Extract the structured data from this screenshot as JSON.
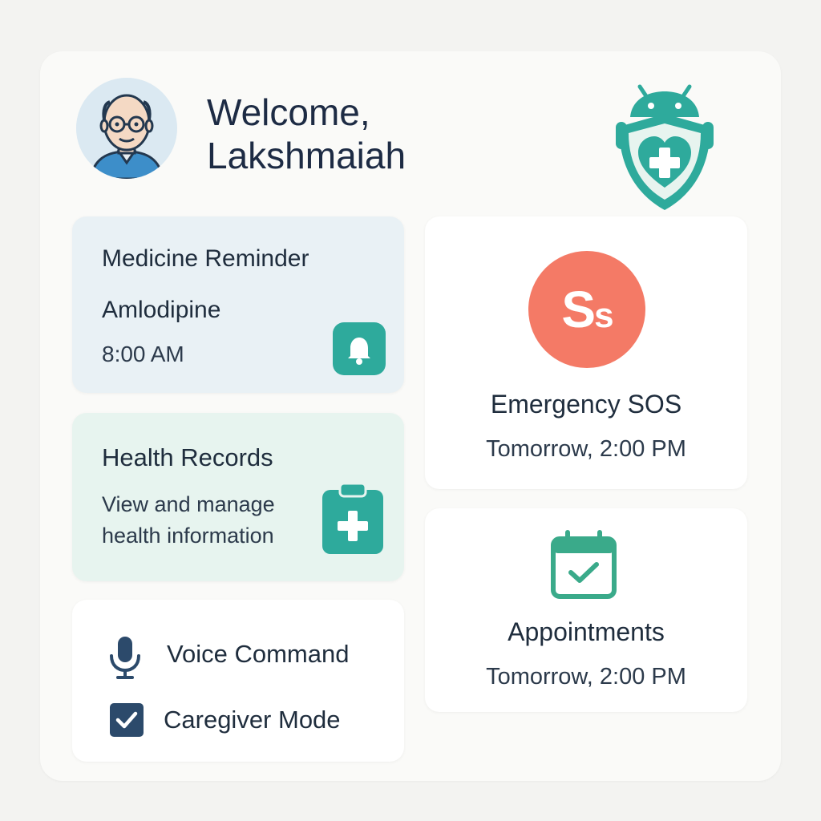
{
  "header": {
    "welcome_line1": "Welcome,",
    "welcome_line2": "Lakshmaiah"
  },
  "medicine_reminder": {
    "title": "Medicine Reminder",
    "medicine": "Amlodipine",
    "time": "8:00 AM",
    "icon": "bell-icon"
  },
  "health_records": {
    "title": "Health Records",
    "desc_line1": "View and manage",
    "desc_line2": "health information",
    "icon": "clipboard-medical-icon"
  },
  "emergency_sos": {
    "badge_big": "S",
    "badge_small": "s",
    "title": "Emergency SOS",
    "subtitle": "Tomorrow, 2:00 PM"
  },
  "appointments": {
    "title": "Appointments",
    "subtitle": "Tomorrow, 2:00 PM",
    "icon": "calendar-check-icon"
  },
  "options": {
    "voice_command": "Voice Command",
    "caregiver_mode": "Caregiver Mode",
    "caregiver_mode_checked": true
  },
  "colors": {
    "teal": "#2eaa9c",
    "coral": "#f47a66",
    "navy": "#2c4a6b",
    "reminder_bg": "#e9f1f5",
    "records_bg": "#e7f4ef"
  }
}
